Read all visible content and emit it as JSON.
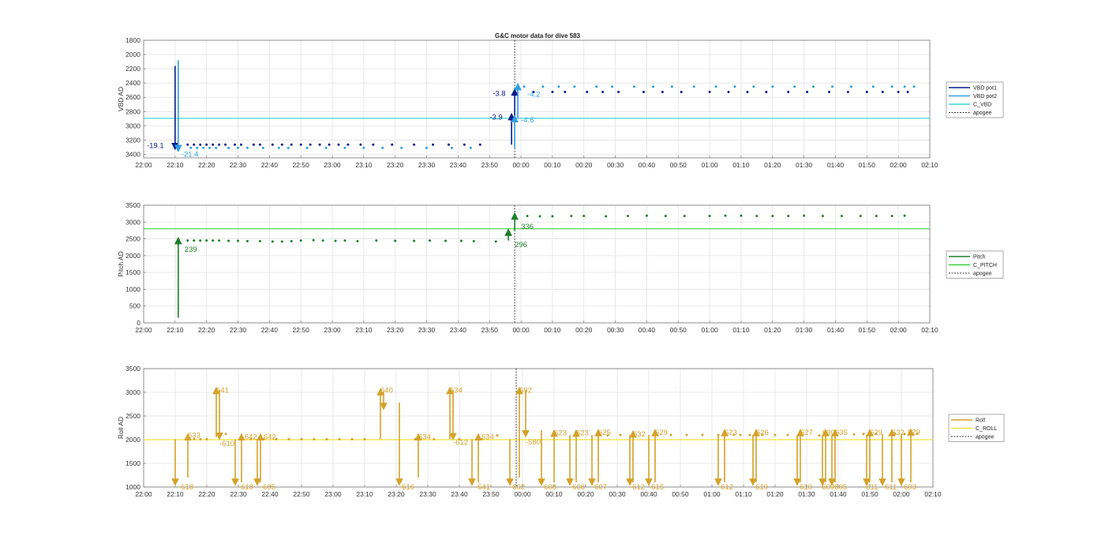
{
  "figure": {
    "title": "G&C motor data for dive 583"
  },
  "colors": {
    "vbd_pot1": "#0a1a8a",
    "vbd_pot2": "#2fa0e0",
    "c_vbd": "#3fd6d6",
    "pitch": "#1e7e2a",
    "c_pitch": "#3ccf3c",
    "roll": "#d4a22a",
    "c_roll": "#f0e040",
    "apogee": "#333333"
  },
  "x_ticks": [
    "22:00",
    "22:10",
    "22:20",
    "22:30",
    "22:40",
    "22:50",
    "23:00",
    "23:10",
    "23:20",
    "23:30",
    "23:40",
    "23:50",
    "00:00",
    "00:10",
    "00:20",
    "00:30",
    "00:40",
    "00:50",
    "01:00",
    "01:10",
    "01:20",
    "01:30",
    "01:40",
    "01:50",
    "02:00",
    "02:10"
  ],
  "chart_data": [
    {
      "type": "scatter",
      "title": "G&C motor data for dive 583",
      "ylabel": "VBD AD",
      "xlim": [
        "22:00",
        "02:10"
      ],
      "ylim": [
        3450,
        1800
      ],
      "y_reversed": true,
      "y_ticks": [
        "1800",
        "2000",
        "2200",
        "2400",
        "2600",
        "2800",
        "3000",
        "3200",
        "3400"
      ],
      "grid": true,
      "legend_position": "right",
      "legend": [
        "VBD pot1",
        "VBD pot2",
        "C_VBD",
        "apogee"
      ],
      "apogee_x": "23:58",
      "series": [
        {
          "name": "VBD pot1",
          "style": "points",
          "color_key": "vbd_pot1",
          "x": [
            "22:14",
            "22:16",
            "22:18",
            "22:20",
            "22:22",
            "22:24",
            "22:26",
            "22:29",
            "22:31",
            "22:35",
            "22:37",
            "22:41",
            "22:44",
            "22:47",
            "22:50",
            "22:53",
            "22:56",
            "22:59",
            "23:02",
            "23:05",
            "23:09",
            "23:13",
            "23:19",
            "23:26",
            "23:32",
            "23:37",
            "23:42",
            "23:47",
            "00:04",
            "00:10",
            "00:14",
            "00:21",
            "00:26",
            "00:31",
            "00:39",
            "00:45",
            "00:51",
            "01:00",
            "01:06",
            "01:12",
            "01:18",
            "01:25",
            "01:31",
            "01:38",
            "01:44",
            "01:50",
            "01:55",
            "02:00",
            "02:03"
          ],
          "y": [
            3265,
            3265,
            3265,
            3265,
            3265,
            3265,
            3265,
            3265,
            3265,
            3265,
            3265,
            3265,
            3265,
            3265,
            3265,
            3265,
            3265,
            3265,
            3265,
            3265,
            3265,
            3265,
            3265,
            3265,
            3265,
            3265,
            3265,
            3265,
            2525,
            2525,
            2525,
            2525,
            2525,
            2525,
            2525,
            2525,
            2525,
            2525,
            2525,
            2525,
            2525,
            2525,
            2525,
            2525,
            2525,
            2525,
            2525,
            2525,
            2525
          ]
        },
        {
          "name": "VBD pot2",
          "style": "points",
          "color_key": "vbd_pot2",
          "x": [
            "22:15",
            "22:17",
            "22:19",
            "22:21",
            "22:23",
            "22:27",
            "22:30",
            "22:33",
            "22:38",
            "22:43",
            "22:46",
            "22:52",
            "22:58",
            "23:04",
            "23:10",
            "23:16",
            "23:22",
            "23:30",
            "23:38",
            "23:44",
            "00:01",
            "00:07",
            "00:12",
            "00:17",
            "00:24",
            "00:29",
            "00:36",
            "00:42",
            "00:48",
            "00:55",
            "01:02",
            "01:08",
            "01:14",
            "01:20",
            "01:27",
            "01:33",
            "01:39",
            "01:45",
            "01:52",
            "01:58",
            "02:02",
            "02:05"
          ],
          "y": [
            3310,
            3310,
            3310,
            3310,
            3310,
            3310,
            3310,
            3310,
            3310,
            3310,
            3310,
            3310,
            3310,
            3310,
            3310,
            3310,
            3310,
            3310,
            3310,
            3310,
            2450,
            2450,
            2450,
            2450,
            2450,
            2450,
            2450,
            2450,
            2450,
            2450,
            2450,
            2450,
            2450,
            2450,
            2450,
            2450,
            2450,
            2450,
            2450,
            2450,
            2450,
            2450
          ]
        },
        {
          "name": "C_VBD",
          "style": "hline",
          "color_key": "c_vbd",
          "y": [
            2895
          ]
        }
      ],
      "moves": [
        {
          "series": "VBD pot1",
          "x": "22:10",
          "from": 2160,
          "to": 3290,
          "label": "-19.1",
          "lx": "22:01",
          "ly": 3280
        },
        {
          "series": "VBD pot2",
          "x": "22:11",
          "from": 2080,
          "to": 3320,
          "label": "-21.4",
          "lx": "22:12",
          "ly": 3400
        },
        {
          "series": "VBD pot1",
          "x": "23:57",
          "from": 3265,
          "to": 2870,
          "label": "-3.9",
          "lx": "23:50",
          "ly": 2880
        },
        {
          "series": "VBD pot1",
          "x": "23:58",
          "from": 2870,
          "to": 2525,
          "label": "-3.8",
          "lx": "23:51",
          "ly": 2550
        },
        {
          "series": "VBD pot2",
          "x": "23:58",
          "from": 3310,
          "to": 2900,
          "label": "-4.6",
          "lx": "00:00",
          "ly": 2920
        },
        {
          "series": "VBD pot2",
          "x": "23:59",
          "from": 2900,
          "to": 2450,
          "label": "-4.2",
          "lx": "00:02",
          "ly": 2560
        }
      ]
    },
    {
      "type": "scatter",
      "ylabel": "Pitch AD",
      "xlim": [
        "22:00",
        "02:10"
      ],
      "ylim": [
        0,
        3500
      ],
      "y_ticks": [
        "0",
        "500",
        "1000",
        "1500",
        "2000",
        "2500",
        "3000",
        "3500"
      ],
      "grid": true,
      "legend_position": "right",
      "legend": [
        "Pitch",
        "C_PITCH",
        "apogee"
      ],
      "apogee_x": "23:58",
      "series": [
        {
          "name": "Pitch",
          "style": "points",
          "color_key": "pitch",
          "x": [
            "22:14",
            "22:16",
            "22:18",
            "22:20",
            "22:22",
            "22:24",
            "22:27",
            "22:30",
            "22:33",
            "22:37",
            "22:41",
            "22:44",
            "22:47",
            "22:50",
            "22:54",
            "22:57",
            "23:01",
            "23:04",
            "23:08",
            "23:14",
            "23:20",
            "23:26",
            "23:31",
            "23:36",
            "23:41",
            "23:45",
            "23:52",
            "00:02",
            "00:06",
            "00:10",
            "00:16",
            "00:20",
            "00:27",
            "00:34",
            "00:40",
            "00:46",
            "00:52",
            "01:00",
            "01:05",
            "01:10",
            "01:15",
            "01:20",
            "01:25",
            "01:30",
            "01:36",
            "01:42",
            "01:48",
            "01:53",
            "01:58",
            "02:02"
          ],
          "y": [
            2450,
            2450,
            2450,
            2450,
            2450,
            2450,
            2440,
            2440,
            2430,
            2430,
            2420,
            2420,
            2430,
            2450,
            2460,
            2450,
            2440,
            2450,
            2430,
            2450,
            2440,
            2440,
            2450,
            2440,
            2440,
            2430,
            2420,
            3180,
            3170,
            3170,
            3180,
            3180,
            3170,
            3180,
            3190,
            3180,
            3180,
            3180,
            3190,
            3190,
            3180,
            3180,
            3180,
            3190,
            3180,
            3180,
            3180,
            3180,
            3180,
            3190
          ]
        },
        {
          "name": "C_PITCH",
          "style": "hline",
          "color_key": "c_pitch",
          "y": [
            2800
          ]
        }
      ],
      "moves": [
        {
          "series": "Pitch",
          "x": "22:11",
          "from": 150,
          "to": 2450,
          "label": "239",
          "lx": "22:13",
          "ly": 2180
        },
        {
          "series": "Pitch",
          "x": "23:56",
          "from": 2450,
          "to": 2700,
          "label": "296",
          "lx": "23:58",
          "ly": 2320
        },
        {
          "series": "Pitch",
          "x": "23:58",
          "from": 2750,
          "to": 3180,
          "label": "336",
          "lx": "00:00",
          "ly": 2860
        }
      ]
    },
    {
      "type": "scatter",
      "ylabel": "Roll AD",
      "xlim": [
        "22:00",
        "02:10"
      ],
      "ylim": [
        1000,
        3500
      ],
      "y_ticks": [
        "1000",
        "1500",
        "2000",
        "2500",
        "3000",
        "3500"
      ],
      "grid": true,
      "legend_position": "right",
      "legend": [
        "Roll",
        "C_ROLL",
        "apogee"
      ],
      "apogee_x": "23:58",
      "series": [
        {
          "name": "Roll",
          "style": "points",
          "color_key": "roll",
          "x": [
            "22:16",
            "22:18",
            "22:20",
            "22:26",
            "22:34",
            "22:38",
            "22:42",
            "22:46",
            "22:50",
            "22:54",
            "22:58",
            "23:02",
            "23:06",
            "23:10",
            "23:26",
            "23:32",
            "23:40",
            "23:47",
            "23:52",
            "00:27",
            "00:31",
            "00:47",
            "00:52",
            "00:57",
            "01:02",
            "01:07",
            "01:09",
            "01:12",
            "01:16",
            "01:20",
            "01:24",
            "01:34",
            "01:45",
            "01:48",
            "01:52",
            "01:58",
            "02:01",
            "02:03",
            "02:05"
          ],
          "y": [
            2010,
            2010,
            2010,
            2120,
            2010,
            2010,
            2010,
            2010,
            2010,
            2010,
            2010,
            2010,
            2010,
            2010,
            2010,
            2010,
            2010,
            2010,
            2090,
            2090,
            2100,
            2100,
            2100,
            2100,
            2100,
            2100,
            2100,
            2100,
            2100,
            2100,
            2100,
            2090,
            2110,
            2120,
            2120,
            2120,
            2120,
            2120,
            2120
          ]
        },
        {
          "name": "C_ROLL",
          "style": "hline",
          "color_key": "c_roll",
          "y": [
            2000
          ]
        }
      ],
      "moves": [
        {
          "x": "22:10",
          "from": 2010,
          "to": 1100,
          "label": "-618",
          "lx": "22:11",
          "ly": 1000
        },
        {
          "x": "22:14",
          "from": 1200,
          "to": 2060,
          "label": "633",
          "lx": "22:14",
          "ly": 2090
        },
        {
          "x": "22:23",
          "from": 2050,
          "to": 3040,
          "label": "641",
          "lx": "22:23",
          "ly": 3040
        },
        {
          "x": "22:24",
          "from": 3040,
          "to": 2070,
          "label": "-610",
          "lx": "22:24",
          "ly": 1920
        },
        {
          "x": "22:29",
          "from": 2010,
          "to": 1100,
          "label": "-618",
          "lx": "22:30",
          "ly": 1000
        },
        {
          "x": "22:31",
          "from": 1100,
          "to": 2060,
          "label": "642",
          "lx": "22:32",
          "ly": 2060
        },
        {
          "x": "22:36",
          "from": 2010,
          "to": 1100,
          "label": "-605",
          "lx": "22:37",
          "ly": 1000
        },
        {
          "x": "22:37",
          "from": 1100,
          "to": 2060,
          "label": "642",
          "lx": "22:38",
          "ly": 2060
        },
        {
          "x": "23:15",
          "from": 2010,
          "to": 3010,
          "label": "640",
          "lx": "23:15",
          "ly": 3040
        },
        {
          "x": "23:16",
          "from": 3010,
          "to": 2700,
          "label": "",
          "lx": "23:16",
          "ly": 2700
        },
        {
          "x": "23:21",
          "from": 2780,
          "to": 1100,
          "label": "-616",
          "lx": "23:21",
          "ly": 1000
        },
        {
          "x": "23:27",
          "from": 1200,
          "to": 2060,
          "label": "634",
          "lx": "23:27",
          "ly": 2060
        },
        {
          "x": "23:37",
          "from": 2010,
          "to": 3040,
          "label": "634",
          "lx": "23:37",
          "ly": 3040
        },
        {
          "x": "23:38",
          "from": 3040,
          "to": 2060,
          "label": "-612",
          "lx": "23:38",
          "ly": 1940
        },
        {
          "x": "23:44",
          "from": 2010,
          "to": 1100,
          "label": "-641",
          "lx": "23:45",
          "ly": 1000
        },
        {
          "x": "23:46",
          "from": 1100,
          "to": 2060,
          "label": "634",
          "lx": "23:47",
          "ly": 2060
        },
        {
          "x": "23:56",
          "from": 2010,
          "to": 1100,
          "label": "-602",
          "lx": "23:56",
          "ly": 1000
        },
        {
          "x": "23:59",
          "from": 1200,
          "to": 3040,
          "label": "592",
          "lx": "23:59",
          "ly": 3040
        },
        {
          "x": "00:01",
          "from": 3040,
          "to": 2120,
          "label": "-580",
          "lx": "00:01",
          "ly": 1950
        },
        {
          "x": "00:06",
          "from": 2200,
          "to": 1100,
          "label": "-608",
          "lx": "00:06",
          "ly": 1000
        },
        {
          "x": "00:10",
          "from": 1100,
          "to": 2140,
          "label": "623",
          "lx": "00:10",
          "ly": 2140
        },
        {
          "x": "00:15",
          "from": 2100,
          "to": 1100,
          "label": "-608",
          "lx": "00:15",
          "ly": 1000
        },
        {
          "x": "00:17",
          "from": 1100,
          "to": 2140,
          "label": "623",
          "lx": "00:17",
          "ly": 2140
        },
        {
          "x": "00:22",
          "from": 2100,
          "to": 1100,
          "label": "-607",
          "lx": "00:22",
          "ly": 1000
        },
        {
          "x": "00:24",
          "from": 1100,
          "to": 2150,
          "label": "625",
          "lx": "00:24",
          "ly": 2150
        },
        {
          "x": "00:34",
          "from": 2100,
          "to": 1100,
          "label": "-612",
          "lx": "00:34",
          "ly": 1000
        },
        {
          "x": "00:35",
          "from": 1100,
          "to": 2120,
          "label": "632",
          "lx": "00:35",
          "ly": 2120
        },
        {
          "x": "00:40",
          "from": 2100,
          "to": 1100,
          "label": "-615",
          "lx": "00:40",
          "ly": 1000
        },
        {
          "x": "00:42",
          "from": 1100,
          "to": 2150,
          "label": "629",
          "lx": "00:42",
          "ly": 2150
        },
        {
          "x": "01:02",
          "from": 2100,
          "to": 1100,
          "label": "-612",
          "lx": "01:02",
          "ly": 1000
        },
        {
          "x": "01:04",
          "from": 1100,
          "to": 2150,
          "label": "623",
          "lx": "01:04",
          "ly": 2150
        },
        {
          "x": "01:13",
          "from": 2100,
          "to": 1100,
          "label": "-610",
          "lx": "01:13",
          "ly": 1000
        },
        {
          "x": "01:14",
          "from": 1100,
          "to": 2150,
          "label": "626",
          "lx": "01:14",
          "ly": 2150
        },
        {
          "x": "01:27",
          "from": 2100,
          "to": 1100,
          "label": "-610",
          "lx": "01:27",
          "ly": 1000
        },
        {
          "x": "01:28",
          "from": 1100,
          "to": 2150,
          "label": "627",
          "lx": "01:28",
          "ly": 2150
        },
        {
          "x": "01:35",
          "from": 2100,
          "to": 1100,
          "label": "-609",
          "lx": "01:34",
          "ly": 1000
        },
        {
          "x": "01:36",
          "from": 1100,
          "to": 2150,
          "label": "630",
          "lx": "01:35",
          "ly": 2150
        },
        {
          "x": "01:38",
          "from": 2100,
          "to": 1100,
          "label": "-605",
          "lx": "01:38",
          "ly": 1000
        },
        {
          "x": "01:39",
          "from": 1100,
          "to": 2150,
          "label": "635",
          "lx": "01:39",
          "ly": 2150
        },
        {
          "x": "01:49",
          "from": 2100,
          "to": 1100,
          "label": "-611",
          "lx": "01:48",
          "ly": 1000
        },
        {
          "x": "01:50",
          "from": 1100,
          "to": 2150,
          "label": "629",
          "lx": "01:50",
          "ly": 2150
        },
        {
          "x": "01:54",
          "from": 2120,
          "to": 1100,
          "label": "-611",
          "lx": "01:54",
          "ly": 1000
        },
        {
          "x": "01:57",
          "from": 1100,
          "to": 2150,
          "label": "632",
          "lx": "01:57",
          "ly": 2150
        },
        {
          "x": "02:00",
          "from": 2120,
          "to": 1100,
          "label": "-603",
          "lx": "02:00",
          "ly": 1000
        },
        {
          "x": "02:03",
          "from": 1100,
          "to": 2160,
          "label": "629",
          "lx": "02:02",
          "ly": 2160
        }
      ]
    }
  ]
}
